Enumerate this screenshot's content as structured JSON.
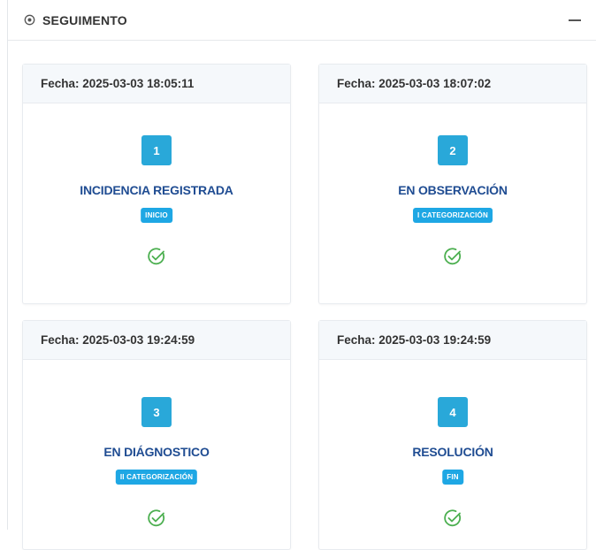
{
  "header": {
    "title": "SEGUIMENTO",
    "icon": "eye-icon",
    "collapse_icon": "minus-icon"
  },
  "colors": {
    "accent": "#29a8d9",
    "title_blue": "#1f4c92",
    "badge": "#1ea7e4",
    "check_green": "#4caf50"
  },
  "steps": [
    {
      "fecha": "Fecha: 2025-03-03 18:05:11",
      "number": "1",
      "title": "INCIDENCIA REGISTRADA",
      "badge": "INICIO",
      "status": "completed"
    },
    {
      "fecha": "Fecha: 2025-03-03 18:07:02",
      "number": "2",
      "title": "EN OBSERVACIÓN",
      "badge": "I CATEGORIZACIÓN",
      "status": "completed"
    },
    {
      "fecha": "Fecha: 2025-03-03 19:24:59",
      "number": "3",
      "title": "EN DIÁGNOSTICO",
      "badge": "II CATEGORIZACIÓN",
      "status": "completed"
    },
    {
      "fecha": "Fecha: 2025-03-03 19:24:59",
      "number": "4",
      "title": "RESOLUCIÓN",
      "badge": "FIN",
      "status": "completed"
    }
  ]
}
